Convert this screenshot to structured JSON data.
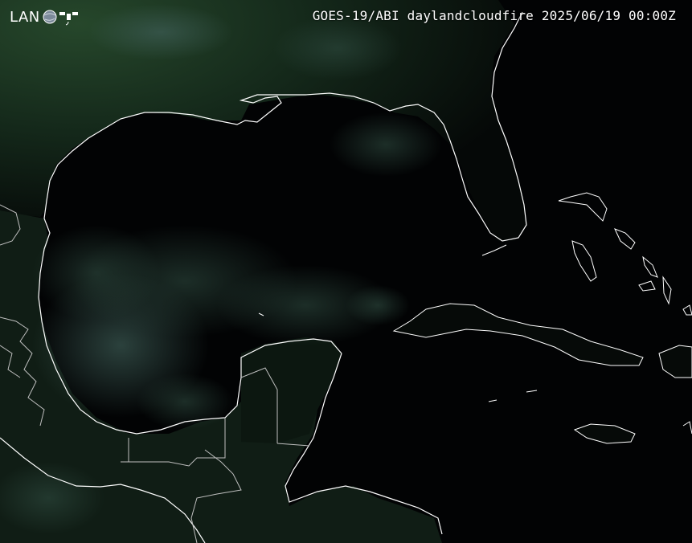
{
  "header": {
    "title": "GOES-19/ABI daylandcloudfire 2025/06/19 00:00Z",
    "logo_text": "LAN",
    "logo_icon": "globe-satellite-icon"
  },
  "colors": {
    "ocean": "#030506",
    "land_dark": "#0d1a12",
    "land_green": "#1e3b22",
    "coastline": "#ffffff",
    "border": "#bfbfbf",
    "cloud": "#3a5a52"
  }
}
